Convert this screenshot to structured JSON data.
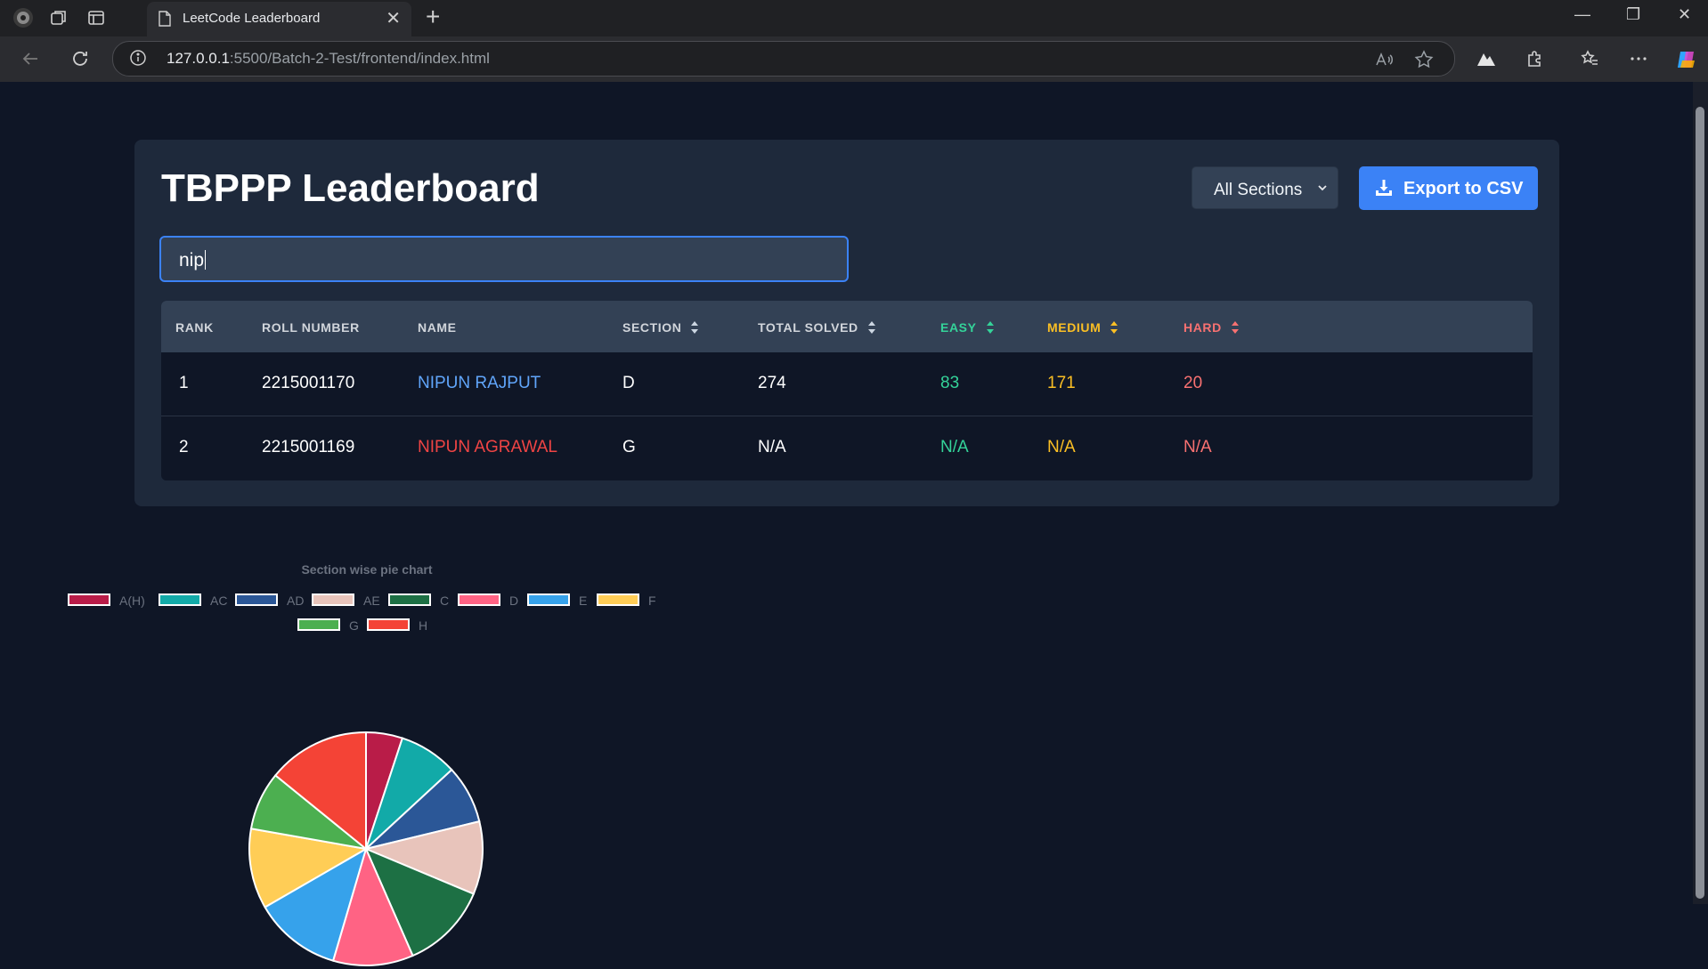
{
  "browser": {
    "tab_title": "LeetCode Leaderboard",
    "url_host": "127.0.0.1",
    "url_rest": ":5500/Batch-2-Test/frontend/index.html"
  },
  "header": {
    "title": "TBPPP Leaderboard",
    "section_select": "All Sections",
    "export_label": "Export to CSV"
  },
  "search": {
    "value": "nip"
  },
  "table": {
    "columns": [
      "RANK",
      "ROLL NUMBER",
      "NAME",
      "SECTION",
      "TOTAL SOLVED",
      "EASY",
      "MEDIUM",
      "HARD"
    ],
    "rows": [
      {
        "rank": "1",
        "roll": "2215001170",
        "name": "NIPUN RAJPUT",
        "section": "D",
        "total": "274",
        "easy": "83",
        "medium": "171",
        "hard": "20"
      },
      {
        "rank": "2",
        "roll": "2215001169",
        "name": "NIPUN AGRAWAL",
        "section": "G",
        "total": "N/A",
        "easy": "N/A",
        "medium": "N/A",
        "hard": "N/A"
      }
    ]
  },
  "colors": {
    "easy": "#34d399",
    "medium": "#fbbf24",
    "hard": "#f87171",
    "name_link": "#60a5fa",
    "name_missing": "#ef4444",
    "accent": "#3b82f6"
  },
  "chart_data": {
    "type": "pie",
    "title": "Section wise pie chart",
    "legend": "top",
    "labels": [
      "A(H)",
      "AC",
      "AD",
      "AE",
      "C",
      "D",
      "E",
      "F",
      "G",
      "H"
    ],
    "values": [
      5,
      8,
      8,
      10,
      12,
      11,
      12,
      11,
      8,
      14
    ],
    "colors": [
      "#b91c48",
      "#12aaa8",
      "#2b5797",
      "#e8c4bb",
      "#1d7044",
      "#ff6384",
      "#36a2eb",
      "#ffcd56",
      "#4caf50",
      "#f44336"
    ]
  }
}
